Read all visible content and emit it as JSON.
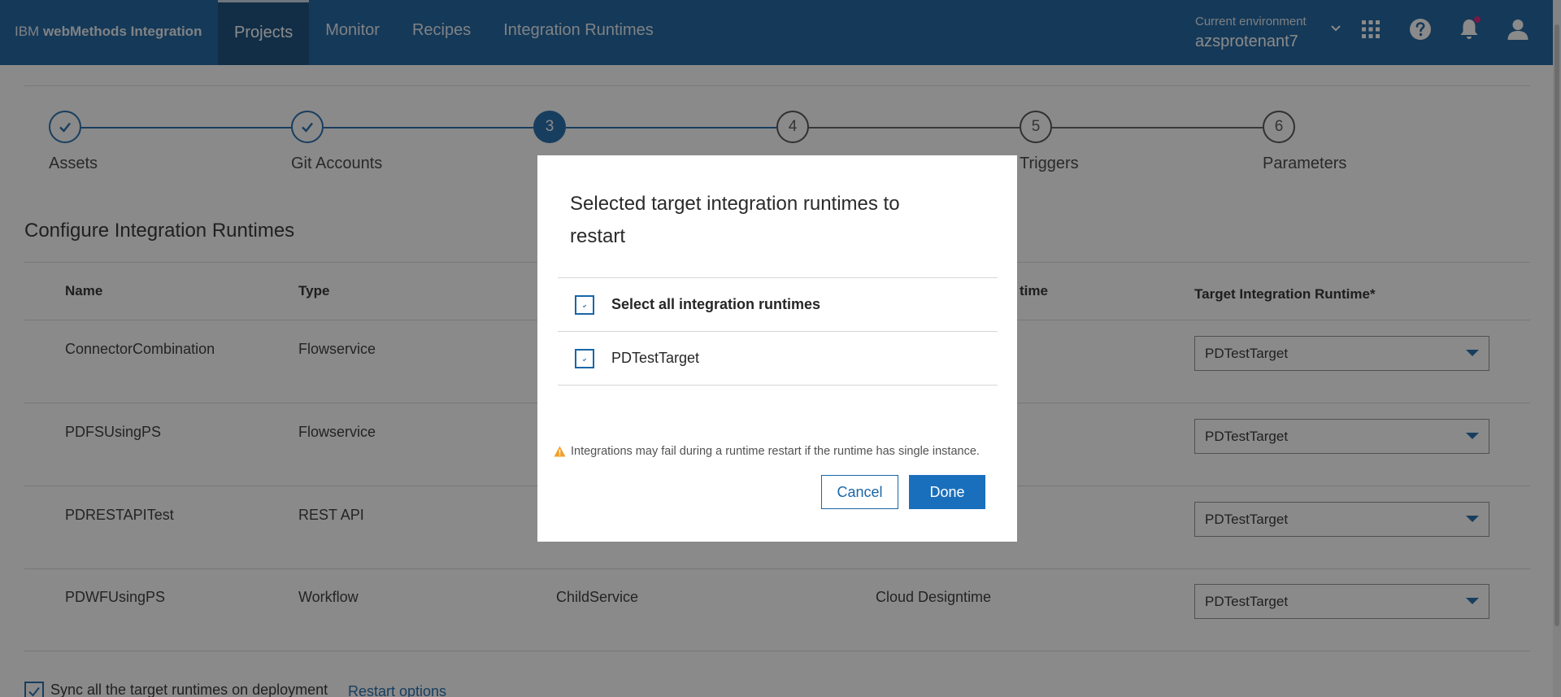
{
  "header": {
    "brand_prefix": "IBM ",
    "brand_name": "webMethods Integration",
    "nav": [
      {
        "label": "Projects",
        "active": true
      },
      {
        "label": "Monitor",
        "active": false
      },
      {
        "label": "Recipes",
        "active": false
      },
      {
        "label": "Integration Runtimes",
        "active": false
      }
    ],
    "environment_label": "Current environment",
    "environment_value": "azsprotenant7",
    "icons": [
      "chevron-down-icon",
      "app-switcher-icon",
      "help-icon",
      "notification-icon",
      "user-icon"
    ]
  },
  "stepper": {
    "steps": [
      {
        "number": "1",
        "label": "Assets",
        "state": "done"
      },
      {
        "number": "2",
        "label": "Git Accounts",
        "state": "done"
      },
      {
        "number": "3",
        "label": "",
        "state": "current"
      },
      {
        "number": "4",
        "label": "",
        "state": "pending"
      },
      {
        "number": "5",
        "label": "Triggers",
        "state": "pending"
      },
      {
        "number": "6",
        "label": "Parameters",
        "state": "pending"
      }
    ]
  },
  "page": {
    "section_title": "Configure Integration Runtimes",
    "columns": {
      "name": "Name",
      "type": "Type",
      "source_runtime_partial": "time",
      "target_runtime": "Target Integration Runtime*"
    },
    "rows": [
      {
        "name": "ConnectorCombination",
        "type": "Flowservice",
        "asset": "",
        "source_runtime": "",
        "target": "PDTestTarget"
      },
      {
        "name": "PDFSUsingPS",
        "type": "Flowservice",
        "asset": "",
        "source_runtime": "",
        "target": "PDTestTarget"
      },
      {
        "name": "PDRESTAPITest",
        "type": "REST API",
        "asset": "",
        "source_runtime": "",
        "target": "PDTestTarget"
      },
      {
        "name": "PDWFUsingPS",
        "type": "Workflow",
        "asset": "ChildService",
        "source_runtime": "Cloud Designtime",
        "target": "PDTestTarget"
      }
    ],
    "sync_label": "Sync all the target runtimes on deployment",
    "sync_checked": true,
    "restart_link": "Restart options"
  },
  "modal": {
    "title": "Selected target integration runtimes to restart",
    "select_all_label": "Select all integration runtimes",
    "runtimes": [
      {
        "label": "PDTestTarget"
      }
    ],
    "warning": "Integrations may fail during a runtime restart if the runtime has single instance.",
    "cancel_label": "Cancel",
    "done_label": "Done"
  },
  "colors": {
    "header_bg": "#155d9b",
    "accent": "#1a66a8",
    "warning": "#f1a02a",
    "notification_dot": "#da1e77"
  }
}
